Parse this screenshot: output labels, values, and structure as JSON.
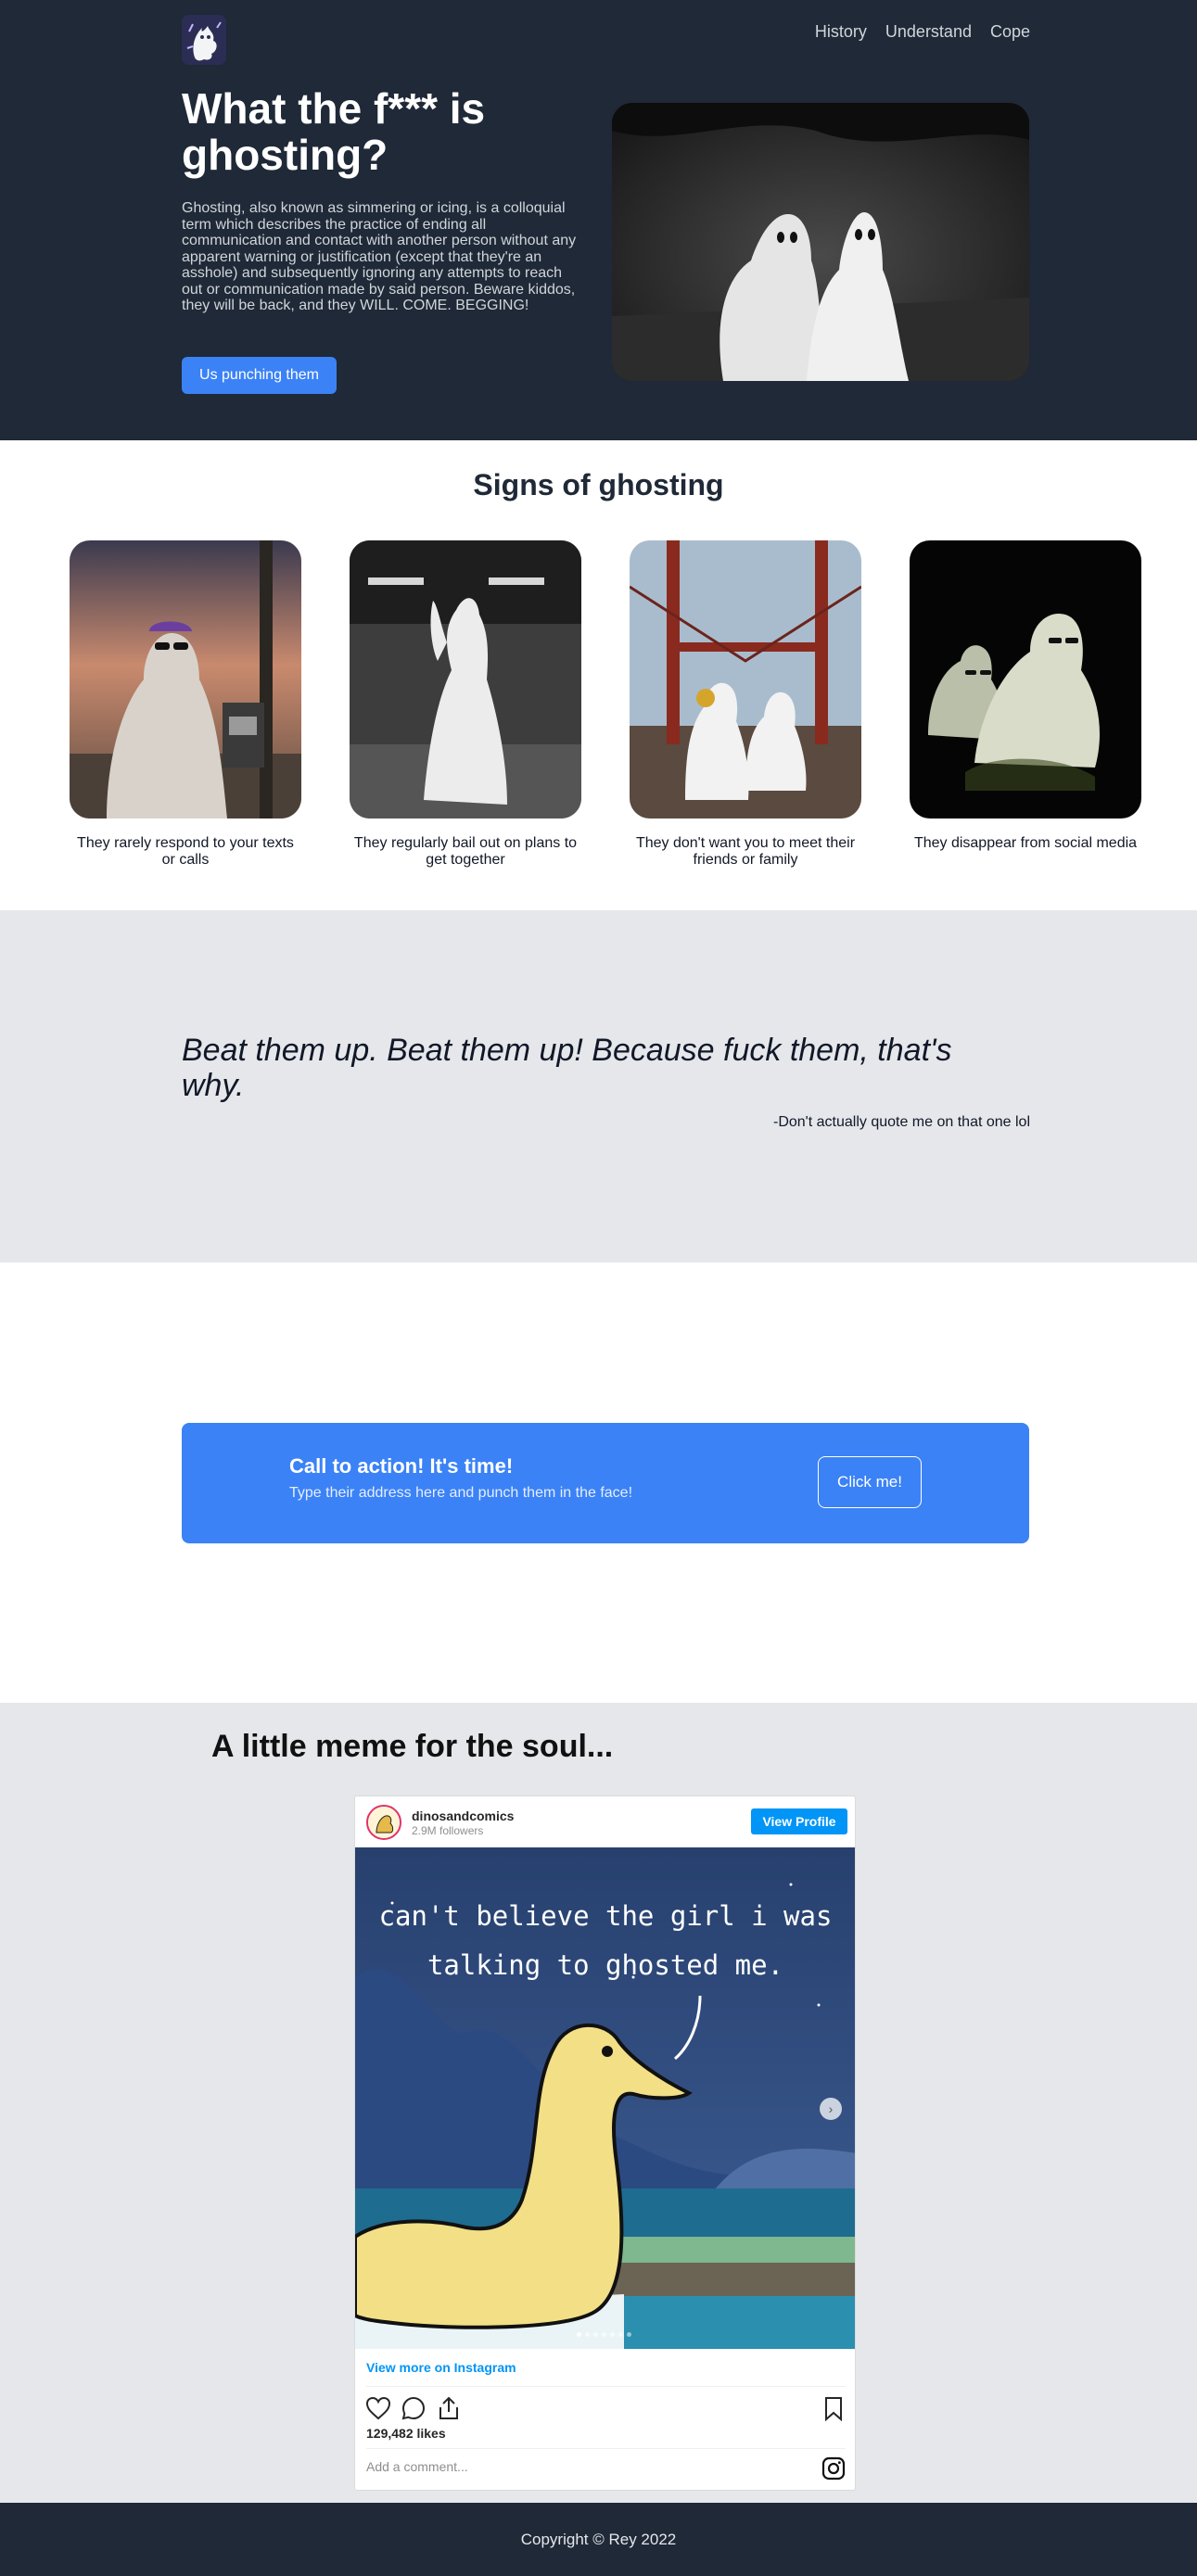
{
  "hero": {
    "nav": [
      "History",
      "Understand",
      "Cope"
    ],
    "title": "What the f*** is ghosting?",
    "description": "Ghosting, also known as simmering or icing, is a colloquial term which describes the practice of ending all communication and contact with another person without any apparent warning or justification (except that they're an asshole) and subsequently ignoring any attempts to reach out or communication made by said person. Beware kiddos, they will be back, and they WILL. COME. BEGGING!",
    "button_label": "Us punching them"
  },
  "signs": {
    "title": "Signs of ghosting",
    "items": [
      {
        "caption": "They rarely respond to your texts or calls"
      },
      {
        "caption": "They regularly bail out on plans to get together"
      },
      {
        "caption": "They don't want you to meet their friends or family"
      },
      {
        "caption": "They disappear from social media"
      }
    ]
  },
  "quote": {
    "text": "Beat them up. Beat them up! Because fuck them, that's why.",
    "author": "-Don't actually quote me on that one lol"
  },
  "cta": {
    "title": "Call to action! It's time!",
    "subtitle": "Type their address here and punch them in the face!",
    "button_label": "Click me!"
  },
  "meme": {
    "title": "A little meme for the soul...",
    "instagram": {
      "username": "dinosandcomics",
      "followers": "2.9M followers",
      "view_profile_label": "View Profile",
      "comic_line1": "can't believe the girl i was",
      "comic_line2": "talking to ghosted me.",
      "view_more_label": "View more on Instagram",
      "likes": "129,482 likes",
      "comment_placeholder": "Add a comment..."
    }
  },
  "footer": {
    "copyright": "Copyright © Rey 2022"
  },
  "colors": {
    "dark": "#1f2937",
    "accent": "#3b82f6",
    "gray": "#e5e7eb",
    "instagram_blue": "#0095f6"
  }
}
